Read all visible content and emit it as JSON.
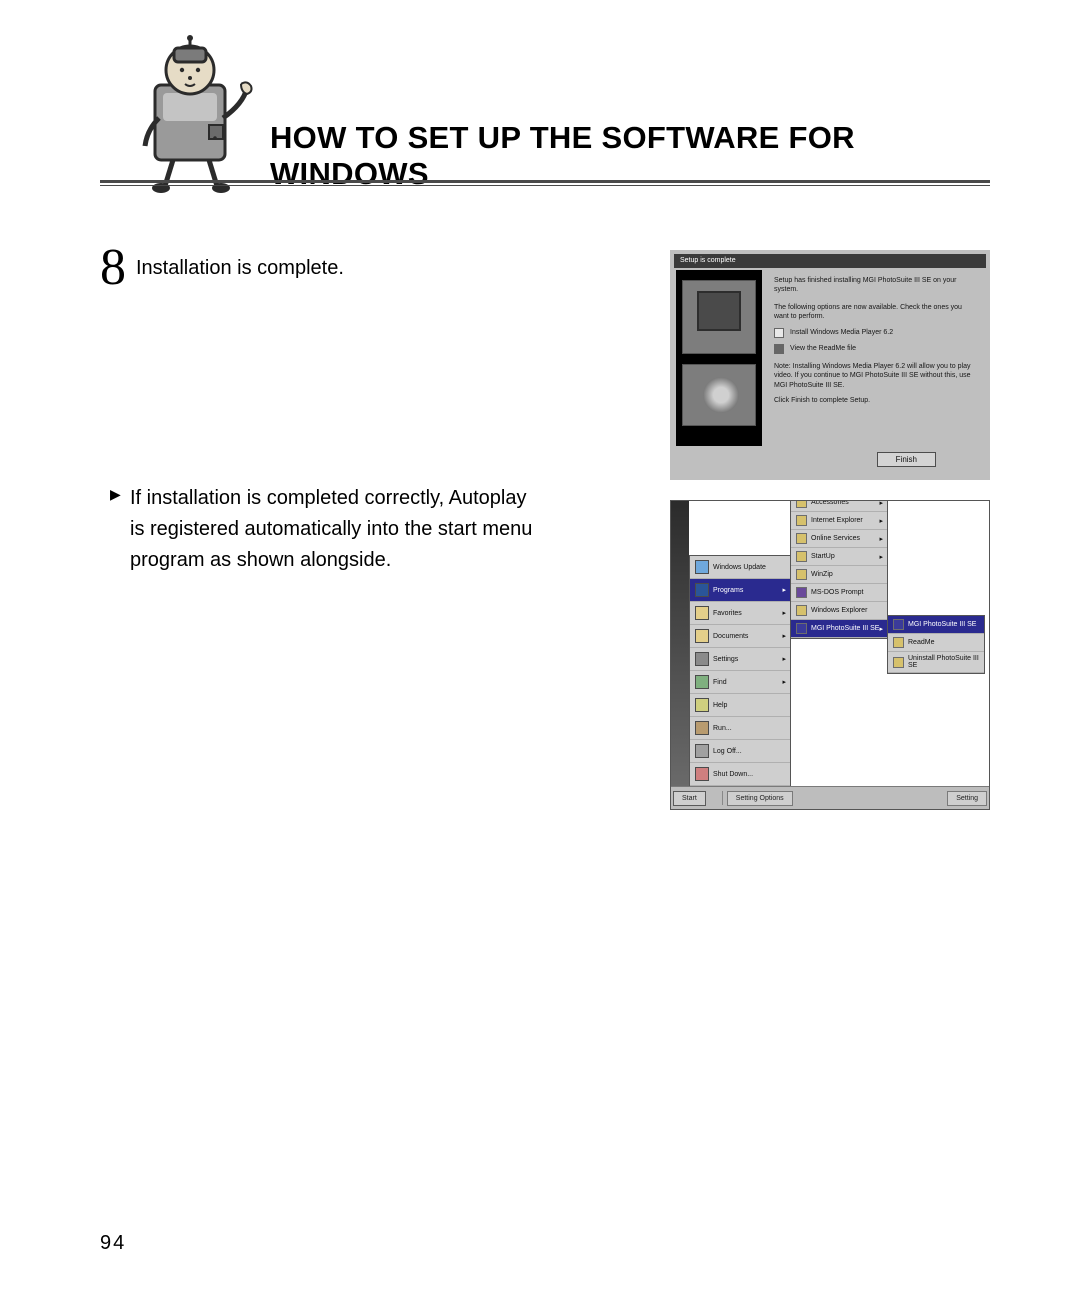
{
  "title": "HOW TO SET UP THE SOFTWARE FOR WINDOWS",
  "step": {
    "number": "8",
    "text": "Installation is complete."
  },
  "bullet": {
    "pointer": "▶",
    "text": "If installation is completed correctly, Autoplay is registered automatically into the start menu program as shown alongside."
  },
  "dialog": {
    "titlebar": "Setup is complete",
    "line1": "Setup has finished installing MGI PhotoSuite III SE on your system.",
    "line2": "The following options are now available. Check the ones you want to perform.",
    "opt1": "Install Windows Media Player 6.2",
    "opt2": "View the ReadMe file",
    "note": "Note: Installing Windows Media Player 6.2 will allow you to play video. If you continue to MGI PhotoSuite III SE without this, use MGI PhotoSuite III SE.",
    "finish_hint": "Click Finish to complete Setup.",
    "button": "Finish"
  },
  "startmenu": {
    "top": "Windows Update",
    "items": [
      "Programs",
      "Favorites",
      "Documents",
      "Settings",
      "Find",
      "Help",
      "Run...",
      "Log Off...",
      "Shut Down..."
    ],
    "programs_sub": [
      "Accessories",
      "Internet Explorer",
      "Online Services",
      "StartUp",
      "WinZip",
      "MS-DOS Prompt",
      "Windows Explorer"
    ],
    "programs_selected": "MGI PhotoSuite III SE",
    "final_sub_title": "MGI PhotoSuite III SE",
    "final_sub": [
      "ReadMe",
      "Uninstall PhotoSuite III SE"
    ]
  },
  "taskbar": {
    "start": "Start",
    "active": "Setting Options",
    "tray": "Setting"
  },
  "page_number": "94"
}
